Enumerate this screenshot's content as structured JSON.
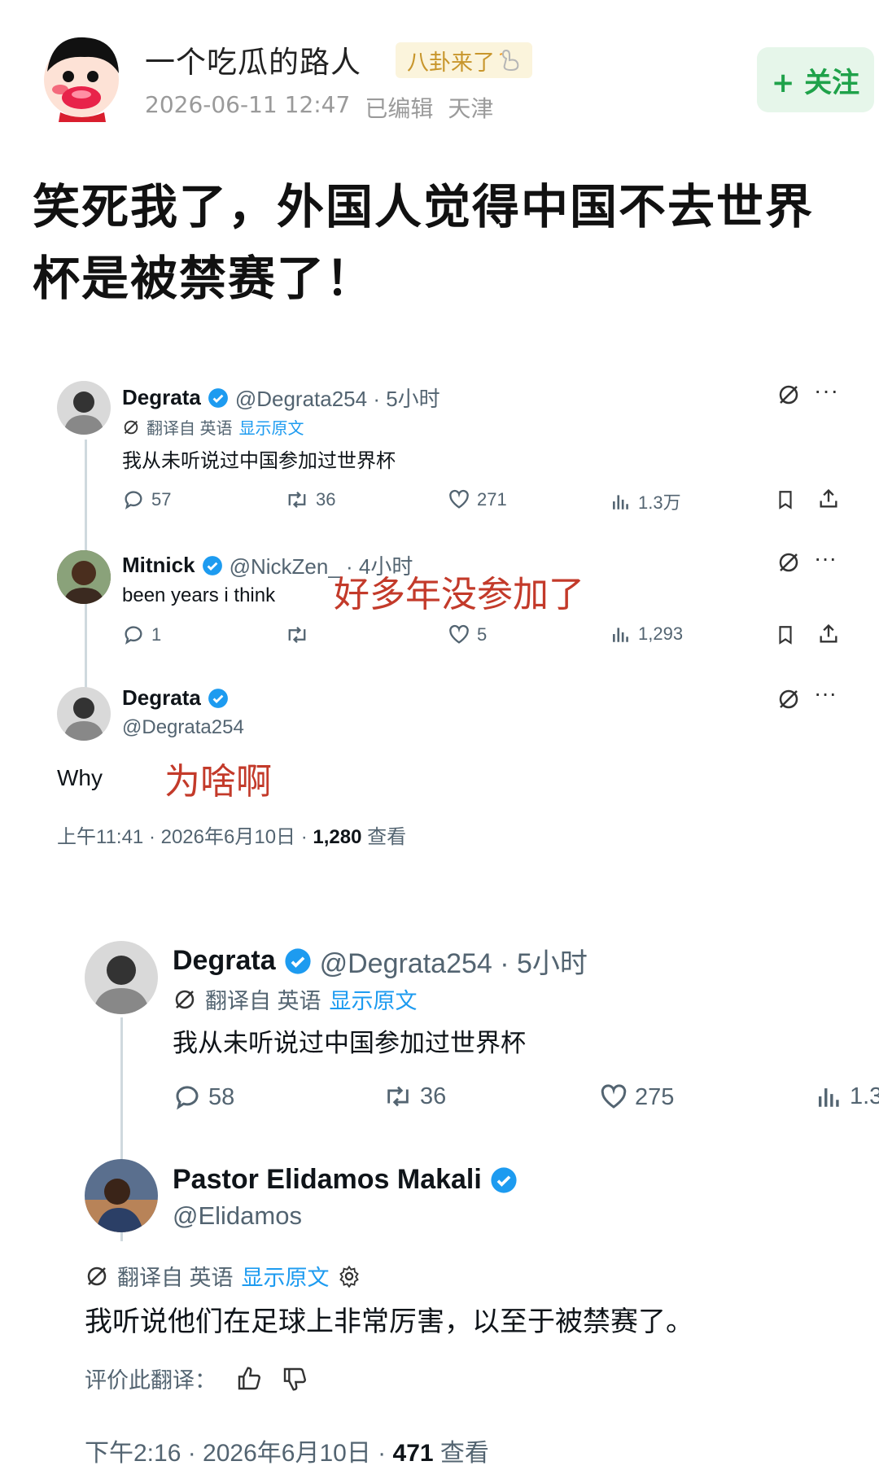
{
  "post": {
    "author": "一个吃瓜的路人",
    "badge": "八卦来了",
    "datetime": "2026-06-11 12:47",
    "edited": "已编辑",
    "location": "天津",
    "follow_label": "+ 关注",
    "title": "笑死我了，外国人觉得中国不去世界杯是被禁赛了！"
  },
  "shot1": {
    "tweet1": {
      "name": "Degrata",
      "handle": "@Degrata254 · 5小时",
      "translate_prefix": "翻译自 英语",
      "show_original": "显示原文",
      "text": "我从未听说过中国参加过世界杯",
      "replies": "57",
      "retweets": "36",
      "likes": "271",
      "views": "1.3万"
    },
    "tweet2": {
      "name": "Mitnick",
      "handle": "@NickZen_ · 4小时",
      "text": "been years i think",
      "note": "好多年没参加了",
      "replies": "1",
      "retweets": "",
      "likes": "5",
      "views": "1,293"
    },
    "tweet3": {
      "name": "Degrata",
      "handle": "@Degrata254",
      "text": "Why",
      "note": "为啥啊",
      "footer_time": "上午11:41 · 2026年6月10日 · ",
      "footer_views": "1,280",
      "footer_views_label": " 查看"
    }
  },
  "shot2": {
    "tweet1": {
      "name": "Degrata",
      "handle": "@Degrata254 · 5小时",
      "translate_prefix": "翻译自 英语",
      "show_original": "显示原文",
      "text": "我从未听说过中国参加过世界杯",
      "replies": "58",
      "retweets": "36",
      "likes": "275",
      "views": "1.3"
    },
    "tweet2": {
      "name": "Pastor Elidamos Makali",
      "handle": "@Elidamos",
      "translate_prefix": "翻译自 英语",
      "show_original": "显示原文",
      "text": "我听说他们在足球上非常厉害，以至于被禁赛了。",
      "rate_label": "评价此翻译：",
      "footer_time": "下午2:16 · 2026年6月10日 · ",
      "footer_views": "471",
      "footer_views_label": " 查看"
    }
  },
  "colors": {
    "x_blue": "#1d9bf0",
    "follow_green": "#1fa24a",
    "note_red": "#c33a2a",
    "muted": "#536471"
  },
  "icons": [
    "reply-icon",
    "retweet-icon",
    "like-icon",
    "views-icon",
    "bookmark-icon",
    "share-icon",
    "grok-icon",
    "more-icon",
    "verified-icon",
    "settings-icon",
    "thumbs-up-icon",
    "thumbs-down-icon"
  ]
}
